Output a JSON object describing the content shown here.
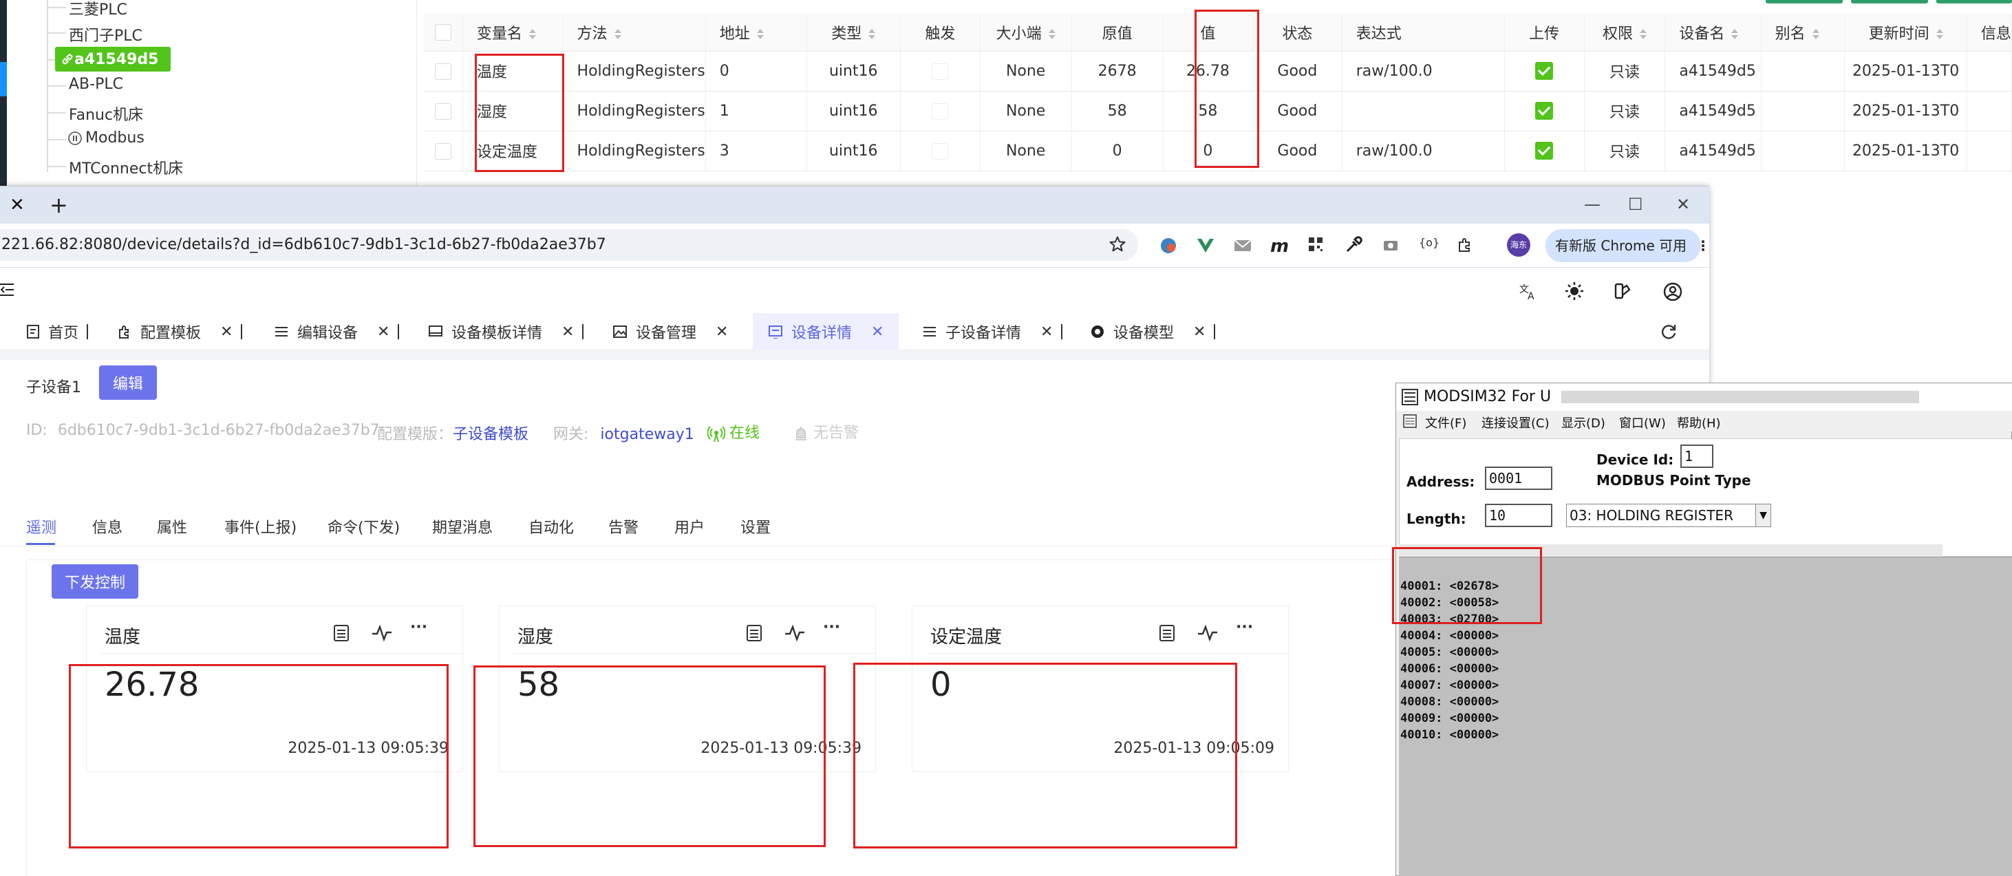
{
  "tree": {
    "items": [
      "三菱PLC",
      "西门子PLC",
      "AB-PLC",
      "Fanuc机床",
      "Modbus",
      "MTConnect机床"
    ],
    "selected": "a41549d5"
  },
  "vartable": {
    "headers": [
      "变量名",
      "方法",
      "地址",
      "类型",
      "触发",
      "大小端",
      "原值",
      "值",
      "状态",
      "表达式",
      "上传",
      "权限",
      "设备名",
      "别名",
      "更新时间",
      "信息"
    ],
    "rows": [
      {
        "name": "温度",
        "method": "HoldingRegisters",
        "addr": "0",
        "type": "uint16",
        "endian": "None",
        "raw": "2678",
        "value": "26.78",
        "status": "Good",
        "expr": "raw/100.0",
        "perm": "只读",
        "device": "a41549d5",
        "time": "2025-01-13T0"
      },
      {
        "name": "湿度",
        "method": "HoldingRegisters",
        "addr": "1",
        "type": "uint16",
        "endian": "None",
        "raw": "58",
        "value": "58",
        "status": "Good",
        "expr": "",
        "perm": "只读",
        "device": "a41549d5",
        "time": "2025-01-13T0"
      },
      {
        "name": "设定温度",
        "method": "HoldingRegisters",
        "addr": "3",
        "type": "uint16",
        "endian": "None",
        "raw": "0",
        "value": "0",
        "status": "Good",
        "expr": "raw/100.0",
        "perm": "只读",
        "device": "a41549d5",
        "time": "2025-01-13T0"
      }
    ]
  },
  "browser": {
    "url": "221.66.82:8080/device/details?d_id=6db610c7-9db1-3c1d-6b27-fb0da2ae37b7",
    "update_label": "有新版 Chrome 可用",
    "profile_label": "海东"
  },
  "page_tabs": [
    "首页",
    "配置模板",
    "编辑设备",
    "设备模板详情",
    "设备管理",
    "设备详情",
    "子设备详情",
    "设备模型"
  ],
  "device": {
    "name": "子设备1",
    "edit_label": "编辑",
    "id_label": "ID:",
    "id_value": "6db610c7-9db1-3c1d-6b27-fb0da2ae37b7",
    "template_label": "配置模版：",
    "template_value": "子设备模板",
    "gateway_label": "网关:",
    "gateway_value": "iotgateway1",
    "online_label": "在线",
    "alarm_label": "无告警"
  },
  "detail_tabs": [
    "遥测",
    "信息",
    "属性",
    "事件(上报)",
    "命令(下发)",
    "期望消息",
    "自动化",
    "告警",
    "用户",
    "设置"
  ],
  "control_button": "下发控制",
  "telemetry": [
    {
      "title": "温度",
      "value": "26.78",
      "time": "2025-01-13 09:05:39"
    },
    {
      "title": "湿度",
      "value": "58",
      "time": "2025-01-13 09:05:39"
    },
    {
      "title": "设定温度",
      "value": "0",
      "time": "2025-01-13 09:05:09"
    }
  ],
  "modsim": {
    "title": "MODSIM32 For U",
    "menu": [
      "文件(F)",
      "连接设置(C)",
      "显示(D)",
      "窗口(W)",
      "帮助(H)"
    ],
    "device_id_label": "Device Id:",
    "device_id": "1",
    "address_label": "Address:",
    "address": "0001",
    "length_label": "Length:",
    "length": "10",
    "point_type_label": "MODBUS Point Type",
    "point_type": "03: HOLDING REGISTER",
    "registers": [
      "40001: <02678>",
      "40002: <00058>",
      "40003: <02700>",
      "40004: <00000>",
      "40005: <00000>",
      "40006: <00000>",
      "40007: <00000>",
      "40008: <00000>",
      "40009: <00000>",
      "40010: <00000>"
    ]
  }
}
